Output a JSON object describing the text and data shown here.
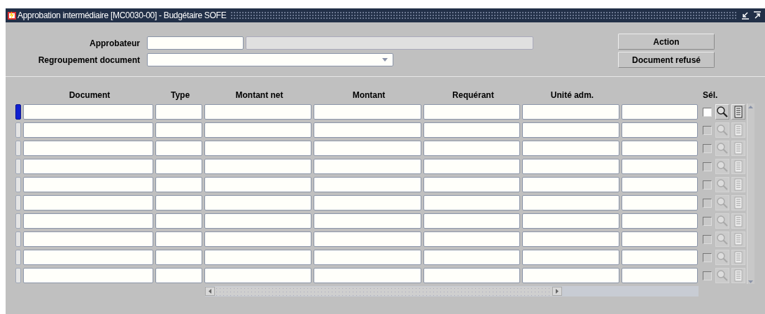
{
  "window": {
    "title": "Approbation intermédiaire [MC0030-00] - Budgétaire SOFE"
  },
  "form": {
    "approver": {
      "label": "Approbateur"
    },
    "grouping": {
      "label": "Regroupement document"
    }
  },
  "buttons": [
    {
      "label": "Action"
    },
    {
      "label": "Document refusé"
    }
  ],
  "table": {
    "columns": [
      "Document",
      "Type",
      "Montant net",
      "Montant",
      "Requérant",
      "Unité adm."
    ],
    "select_header": "Sél.",
    "rows": [
      {
        "selected": true,
        "enabled": true,
        "checked": false
      },
      {
        "selected": false,
        "enabled": false,
        "checked": false
      },
      {
        "selected": false,
        "enabled": false,
        "checked": false
      },
      {
        "selected": false,
        "enabled": false,
        "checked": false
      },
      {
        "selected": false,
        "enabled": false,
        "checked": false
      },
      {
        "selected": false,
        "enabled": false,
        "checked": false
      },
      {
        "selected": false,
        "enabled": false,
        "checked": false
      },
      {
        "selected": false,
        "enabled": false,
        "checked": false
      },
      {
        "selected": false,
        "enabled": false,
        "checked": false
      },
      {
        "selected": false,
        "enabled": false,
        "checked": false
      }
    ]
  }
}
